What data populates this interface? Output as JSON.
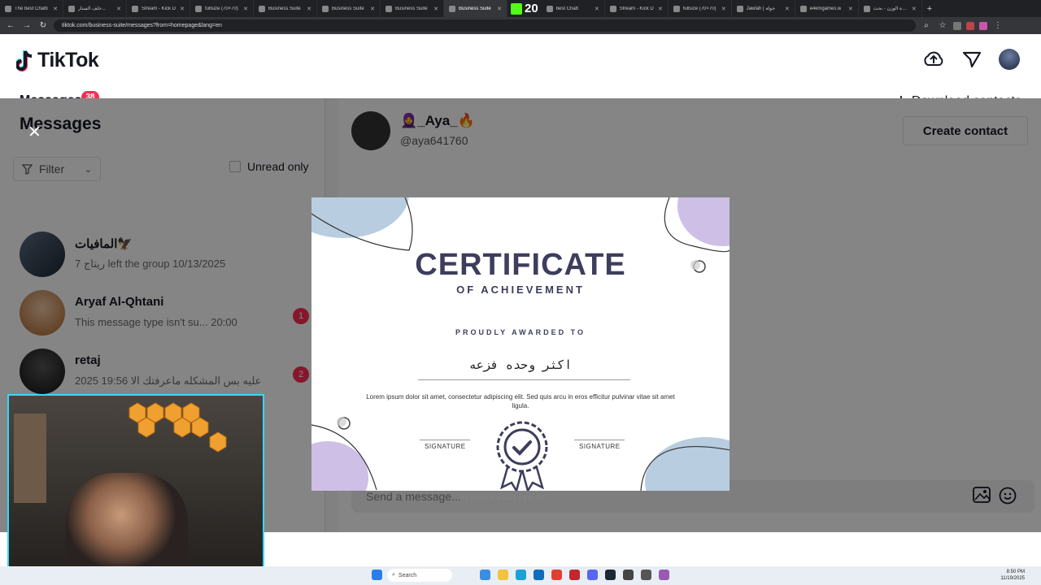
{
  "browser": {
    "tabs": [
      {
        "title": "The best Chatti",
        "active": false
      },
      {
        "title": "خلف الستار...",
        "active": false
      },
      {
        "title": "Stream - Kick D",
        "active": false
      },
      {
        "title": "fullsize (70×70)",
        "active": false
      },
      {
        "title": "Business Suite",
        "active": false
      },
      {
        "title": "Business Suite",
        "active": false
      },
      {
        "title": "Business Suite",
        "active": false
      },
      {
        "title": "Business Suite",
        "active": true
      },
      {
        "title": "best Chatt",
        "active": false
      },
      {
        "title": "Stream - Kick D",
        "active": false
      },
      {
        "title": "fullsize (70×70)",
        "active": false
      },
      {
        "title": "Jawlah | جولة",
        "active": false
      },
      {
        "title": "e4kmgames.w",
        "active": false
      },
      {
        "title": "سيرة الوزن - بحث",
        "active": false
      }
    ],
    "overlay_counter": "20",
    "url": "tiktok.com/business-suite/messages?from=homepage&lang=en"
  },
  "header": {
    "logo_text": "TikTok",
    "tab_label": "Messages",
    "badge_count": "38",
    "download_label": "Download contacts"
  },
  "sidebar": {
    "heading": "Messages",
    "filter_label": "Filter",
    "unread_label": "Unread only",
    "conversations": [
      {
        "name": "المافيات🦅",
        "preview": "7 ريتاج left the group 10/13/2025",
        "unread": ""
      },
      {
        "name": "Aryaf Al-Qhtani",
        "preview": "This message type isn't su... 20:00",
        "unread": "1"
      },
      {
        "name": "retaj",
        "preview": "2025 عليه بس المشكله ماعرفتك الا  19:56",
        "unread": "2"
      }
    ]
  },
  "chat": {
    "name": "🧕_Aya_🔥",
    "handle": "@aya641760",
    "create_contact_label": "Create contact",
    "send_placeholder": "Send a message..."
  },
  "certificate": {
    "title": "CERTIFICATE",
    "subtitle": "OF ACHIEVEMENT",
    "awarded_label": "PROUDLY AWARDED TO",
    "recipient": "اكثر وحده فزعه",
    "body": "Lorem ipsum dolor sit amet, consectetur adipiscing elit. Sed quis arcu in eros efficitur pulvinar vitae sit amet ligula.",
    "signature_left": "SIGNATURE",
    "signature_right": "SIGNATURE",
    "under_text": "PROUDLY AWARDED TO"
  },
  "taskbar": {
    "search_label": "Search",
    "time": "8:50 PM",
    "date": "11/19/2025"
  },
  "colors": {
    "accent": "#fe2c55",
    "certificate_text": "#3d3d5c",
    "webcam_border": "#38d7ff",
    "blob_blue": "#b9cde0",
    "blob_purple": "#cdbfe6"
  }
}
